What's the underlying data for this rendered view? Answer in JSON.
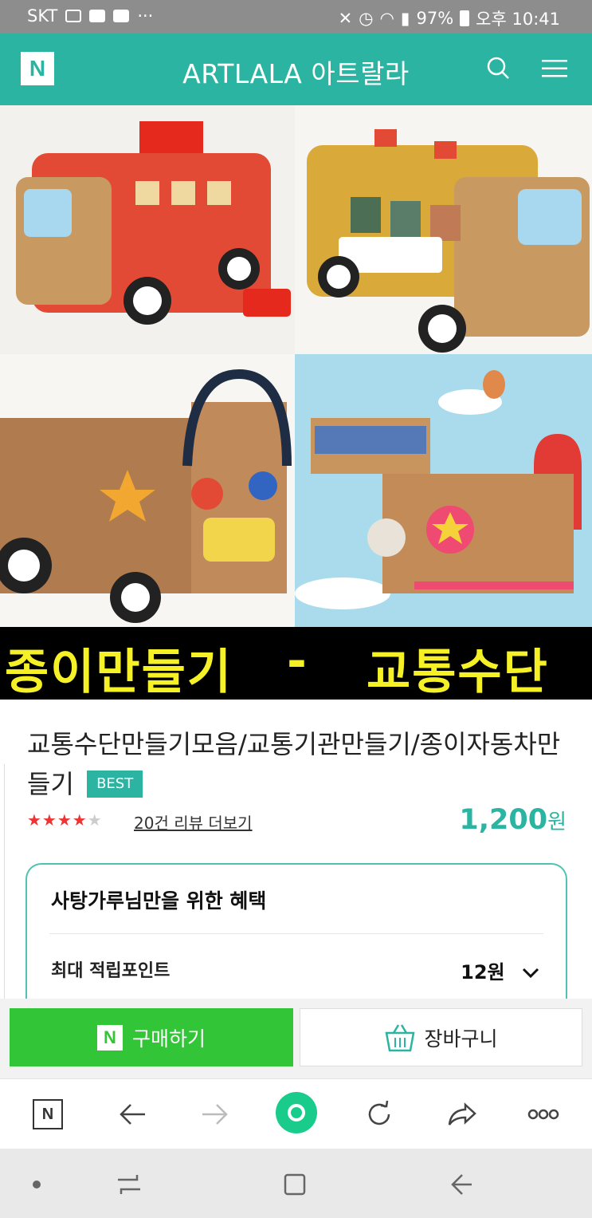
{
  "status_bar": {
    "carrier": "SKT",
    "notifications": [
      "gallery-icon",
      "youtube-icon",
      "note-icon"
    ],
    "more": "···",
    "battery": "97%",
    "time": "오후 10:41"
  },
  "app_bar": {
    "logo": "N",
    "title": "ARTLALA 아트랄라",
    "icons": [
      "search-icon",
      "menu-icon"
    ]
  },
  "hero": {
    "banner_left": "종이만들기",
    "banner_dash": "-",
    "banner_right": "교통수단"
  },
  "product": {
    "title": "교통수단만들기모음/교통기관만들기/종이자동차만들기",
    "badge": "BEST",
    "rating": 4,
    "rating_max": 5,
    "rating_stars_on": "★★★★",
    "rating_stars_off": "★",
    "reviews_link": "20건 리뷰 더보기",
    "price": "1,200",
    "price_unit": "원"
  },
  "benefit": {
    "title": "사탕가루님만을 위한 혜택",
    "point_label": "최대 적립포인트",
    "point_value": "12원"
  },
  "actions": {
    "buy_icon": "N",
    "buy_label": "구매하기",
    "cart_label": "장바구니"
  },
  "browser_bar": {
    "naver_icon": "N",
    "icons": [
      "naver-icon",
      "back-icon",
      "forward-icon",
      "home-icon",
      "refresh-icon",
      "share-icon",
      "more-icon"
    ]
  },
  "android_nav": {
    "icons": [
      "dot-icon",
      "recent-apps-icon",
      "home-square-icon",
      "back-arrow-icon"
    ]
  },
  "colors": {
    "brand": "#2bb4a1",
    "buy_green": "#33c538",
    "banner_yellow": "#f5f126",
    "rating_red": "#e33"
  }
}
